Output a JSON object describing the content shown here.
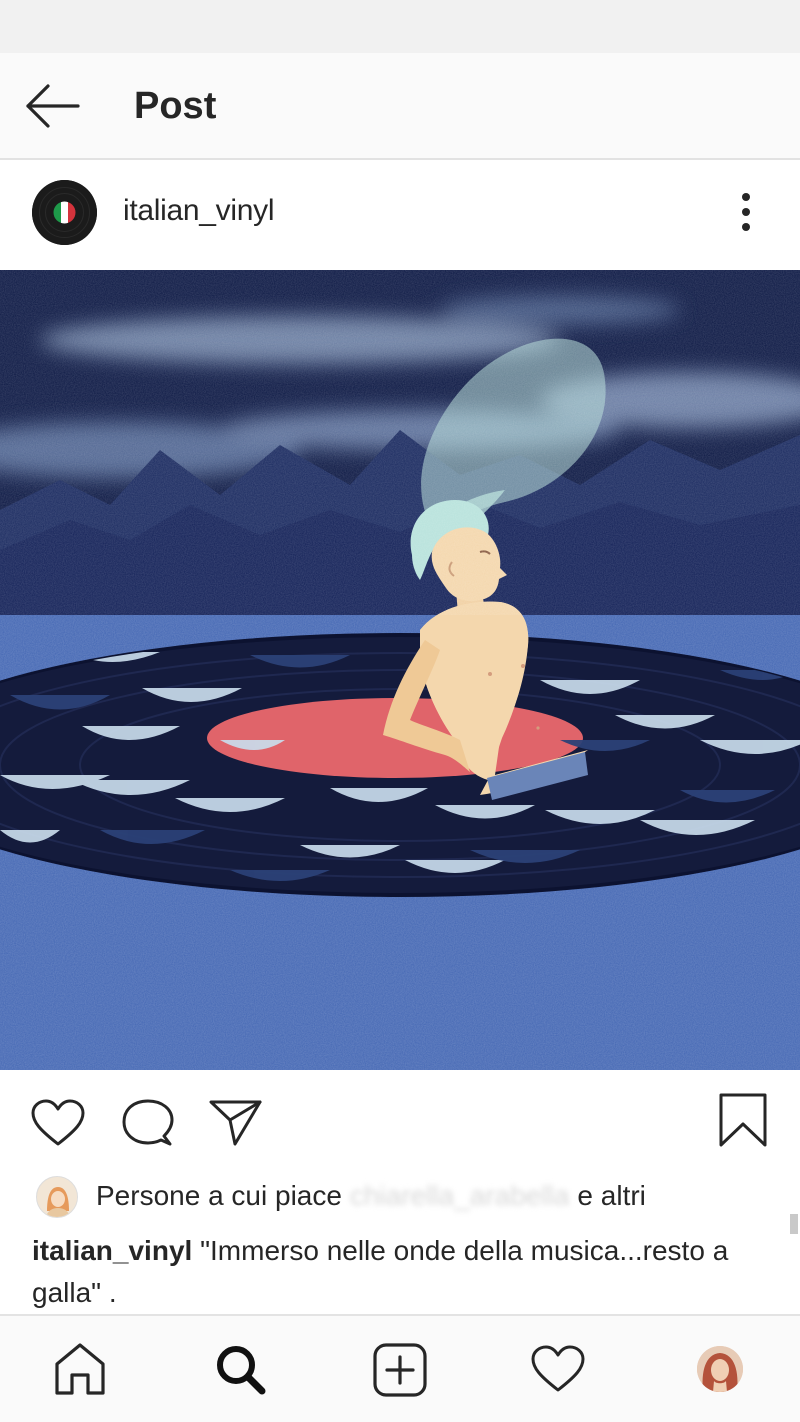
{
  "header": {
    "title": "Post",
    "back_icon": "arrow-left-icon"
  },
  "post": {
    "username": "italian_vinyl",
    "avatar_icon": "vinyl-italian-flag-icon",
    "more_icon": "more-vertical-icon",
    "image_description_icon": "illustration-man-in-vinyl-sea",
    "actions": {
      "like_icon": "heart-icon",
      "comment_icon": "comment-icon",
      "share_icon": "send-icon",
      "save_icon": "bookmark-icon"
    },
    "likes": {
      "prefix": "Persone a cui piace",
      "liker": "chiarella_arabella",
      "suffix": "e altri"
    },
    "caption": {
      "user": "italian_vinyl",
      "text": " \"Immerso nelle onde della musica...resto a galla\" ."
    }
  },
  "bottom_nav": {
    "home_icon": "home-icon",
    "search_icon": "search-icon",
    "add_icon": "add-post-icon",
    "activity_icon": "heart-icon",
    "profile_icon": "profile-avatar"
  },
  "colors": {
    "sky": "#0f1c46",
    "sea": "#4467b3",
    "record": "#141b3a",
    "label": "#e0646a",
    "skin": "#f4d7ad",
    "hair": "#b8e2dc"
  }
}
